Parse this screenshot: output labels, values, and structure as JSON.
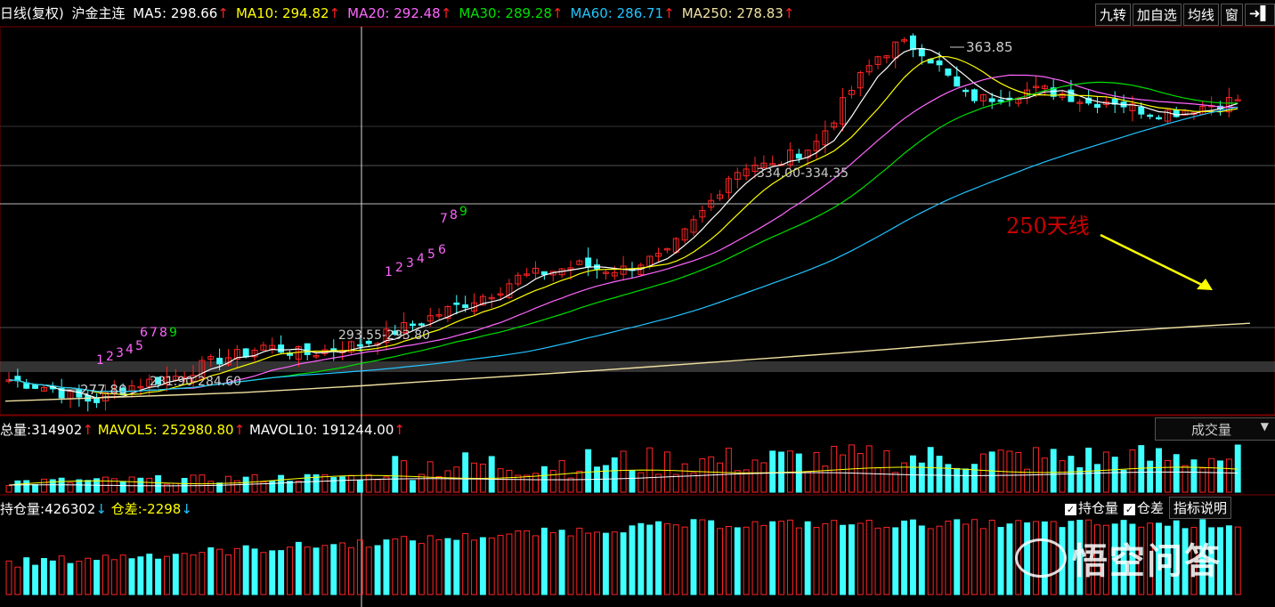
{
  "header": {
    "prefix": "日线(复权)",
    "symbol": "沪金主连",
    "ma": [
      {
        "label": "MA5: 298.66",
        "color": "#ffffff"
      },
      {
        "label": "MA10: 294.82",
        "color": "#ffff00"
      },
      {
        "label": "MA20: 292.48",
        "color": "#ff66ff"
      },
      {
        "label": "MA30: 289.28",
        "color": "#00e000"
      },
      {
        "label": "MA60: 286.71",
        "color": "#22c4ff"
      },
      {
        "label": "MA250: 278.83",
        "color": "#f0e0a0"
      }
    ],
    "up_arrow": "↑"
  },
  "toolbar": [
    "九转",
    "加自选",
    "均线",
    "窗",
    "➜▌"
  ],
  "volume": {
    "total_label": "总量:",
    "total_value": "314902",
    "mavol5": "MAVOL5: 252980.80",
    "mavol10": "MAVOL10: 191244.00",
    "selector": "成交量"
  },
  "open_interest": {
    "label": "持仓量:",
    "value": "426302",
    "diff_label": "仓差:",
    "diff_value": "-2298",
    "down_arrow": "↓",
    "opt1": "持仓量",
    "opt2": "仓差",
    "explain": "指标说明"
  },
  "annotations": {
    "high": "363.85",
    "low": "277.80",
    "range1": "281.90-284.60",
    "range2": "293.55-293.80",
    "range3": "334.00-334.35",
    "ma250_note": "250天线",
    "seq1": [
      "1",
      "2",
      "3",
      "4",
      "5"
    ],
    "seq1b": [
      "6",
      "7",
      "8",
      "9"
    ],
    "seq2": [
      "1",
      "2",
      "3",
      "4",
      "5",
      "6"
    ],
    "seq2b": [
      "7",
      "8",
      "9"
    ]
  },
  "watermark": "悟空问答",
  "colors": {
    "up": "#ff2424",
    "down": "#40ffff",
    "ma5": "#ffffff",
    "ma10": "#ffff00",
    "ma20": "#ff66ff",
    "ma30": "#00e000",
    "ma60": "#22c4ff",
    "ma250": "#f0e0a0"
  },
  "chart_data": {
    "type": "candlestick",
    "ylim": [
      275,
      366
    ],
    "highlighted_high": 363.85,
    "highlighted_low": 277.8,
    "close_series_approx": [
      283,
      282,
      281,
      279,
      278,
      280,
      282,
      283,
      284,
      286,
      288,
      289,
      291,
      290,
      289,
      290,
      291,
      292,
      294,
      296,
      298,
      300,
      302,
      304,
      307,
      308,
      309,
      310,
      309,
      309,
      311,
      312,
      318,
      324,
      331,
      334,
      333,
      336,
      338,
      345,
      353,
      359,
      362,
      361,
      356,
      350,
      349,
      350,
      351,
      351,
      350,
      348,
      349,
      347,
      346,
      346,
      347,
      348,
      349
    ],
    "ma250_series_approx": [
      278,
      278.5,
      279,
      279.5,
      280,
      280.8,
      281.6,
      282.5,
      283.4,
      284.3,
      285.2,
      286.2,
      287.2,
      288.2,
      289.2,
      290.3,
      291.4,
      292.5,
      293.6,
      294.6,
      295.5,
      296.3
    ],
    "volume_max": 315000,
    "oi_value": 426302
  }
}
